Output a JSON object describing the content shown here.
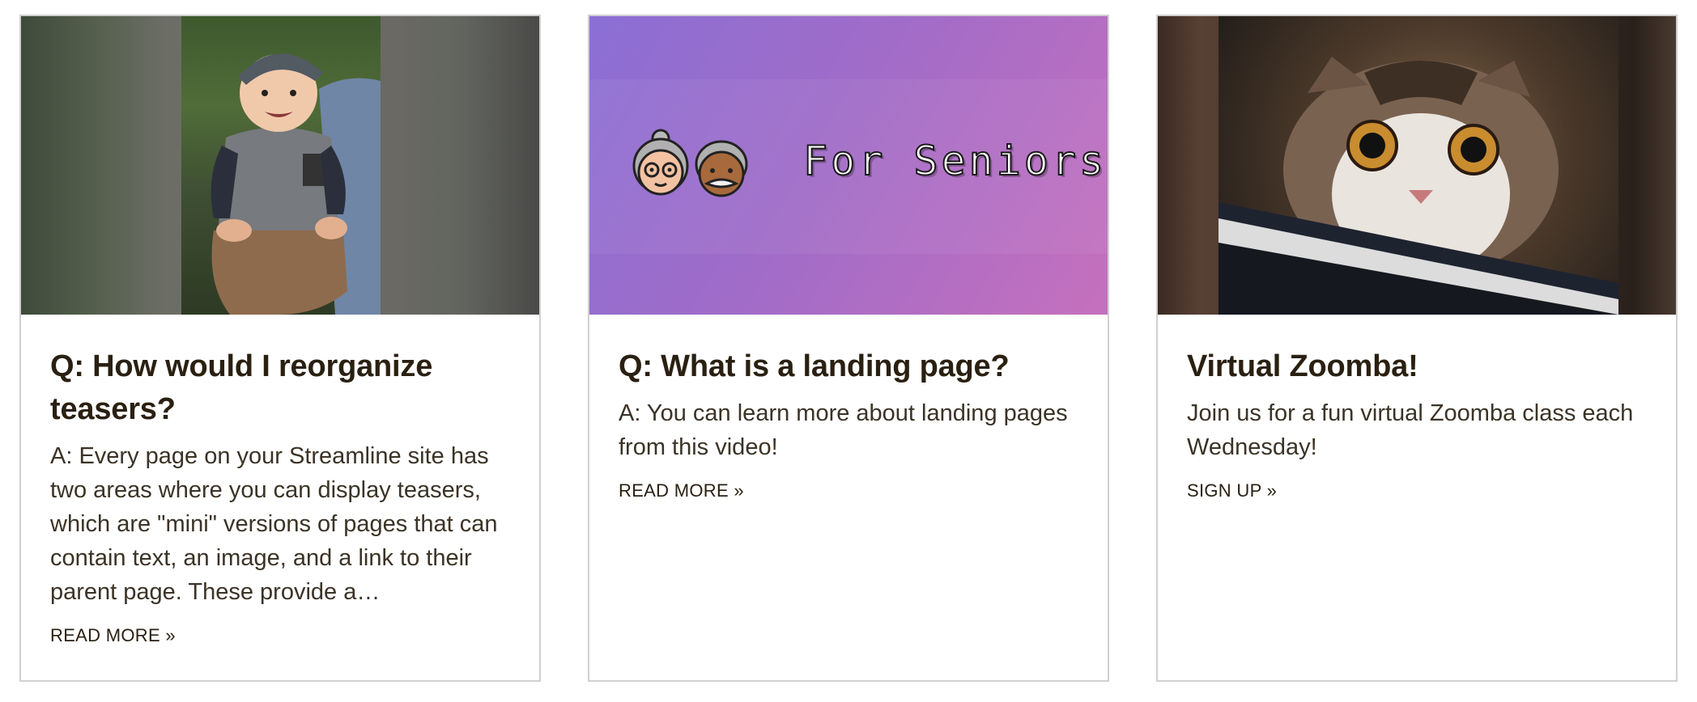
{
  "cards": [
    {
      "title": "Q: How would I reorganize teasers?",
      "excerpt": "A: Every page on your Streamline site has two areas where you can display teasers, which are \"mini\" versions of pages that can contain text, an image, and a link to their parent page. These provide a…",
      "link": "READ MORE »"
    },
    {
      "title": "Q: What is a landing page?",
      "excerpt": "A: You can learn more about landing pages from this video!",
      "link": "READ MORE »",
      "banner_text": "For Seniors"
    },
    {
      "title": "Virtual Zoomba!",
      "excerpt": "Join us for a fun virtual Zoomba class each Wednesday!",
      "link": "SIGN UP »"
    }
  ],
  "colors": {
    "heading": "#2a2011",
    "text": "#3b3326",
    "border": "#d0d0d0"
  }
}
